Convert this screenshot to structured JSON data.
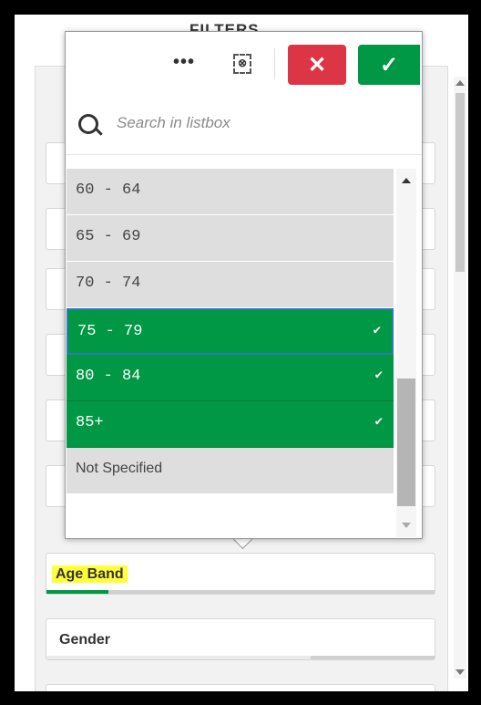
{
  "panel": {
    "title": "FILTERS"
  },
  "popup": {
    "toolbar": {
      "more_icon": "•••",
      "clear_icon": "⊗",
      "cancel_icon": "✕",
      "confirm_icon": "✓",
      "accent_cancel": "#dc3545",
      "accent_confirm": "#009845"
    },
    "search": {
      "placeholder": "Search in listbox",
      "icon": "search-icon"
    },
    "items": [
      {
        "label": "60 - 64",
        "state": "excluded"
      },
      {
        "label": "65 - 69",
        "state": "excluded"
      },
      {
        "label": "70 - 74",
        "state": "excluded"
      },
      {
        "label": "75 - 79",
        "state": "selected",
        "check": "✔"
      },
      {
        "label": "80 - 84",
        "state": "selected",
        "check": "✔"
      },
      {
        "label": "85+",
        "state": "selected",
        "check": "✔"
      },
      {
        "label": "Not Specified",
        "state": "excluded"
      }
    ]
  },
  "filters": [
    {
      "label": "Age Band",
      "fill": 0.16
    },
    {
      "label": "Gender",
      "fill": 0.68
    }
  ],
  "colors": {
    "selected": "#009845",
    "excluded": "#dedede",
    "highlight": "#ffff3a"
  }
}
